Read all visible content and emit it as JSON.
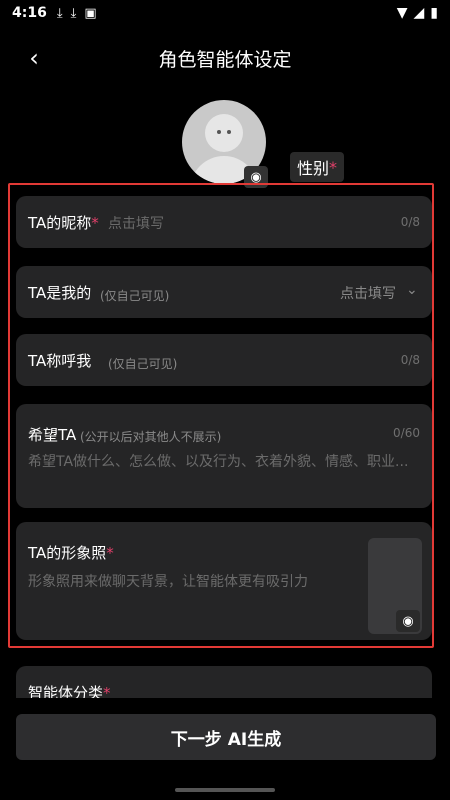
{
  "status_bar": {
    "time": "4:16",
    "icons": [
      "download-icon",
      "download-icon",
      "app-icon"
    ],
    "right_icons": [
      "wifi-icon",
      "signal-icon",
      "battery-icon"
    ]
  },
  "nav": {
    "back_icon": "chevron-left-icon",
    "title": "角色智能体设定"
  },
  "avatar": {
    "camera_icon": "camera-icon"
  },
  "gender": {
    "label": "性别",
    "required_mark": "*"
  },
  "fields": {
    "nickname": {
      "label": "TA的昵称",
      "required_mark": "*",
      "placeholder": "点击填写",
      "counter": "0/8"
    },
    "relation": {
      "label": "TA是我的",
      "note": "(仅自己可见)",
      "fill_text": "点击填写",
      "icon": "chevron-down-icon"
    },
    "call_me": {
      "label": "TA称呼我",
      "note": "(仅自己可见)",
      "counter": "0/8"
    },
    "hope": {
      "label": "希望TA",
      "note": "(公开以后对其他人不展示)",
      "counter": "0/60",
      "placeholder": "希望TA做什么、怎么做、以及行为、衣着外貌、情感、职业..."
    },
    "image": {
      "label": "TA的形象照",
      "required_mark": "*",
      "placeholder": "形象照用来做聊天背景，让智能体更有吸引力",
      "camera_icon": "camera-icon"
    },
    "category": {
      "label": "智能体分类",
      "required_mark": "*"
    }
  },
  "next_button": {
    "label": "下一步 AI生成"
  },
  "colors": {
    "background": "#000000",
    "card": "#252526",
    "highlight": "#e23a36",
    "required": "#e0406a"
  }
}
